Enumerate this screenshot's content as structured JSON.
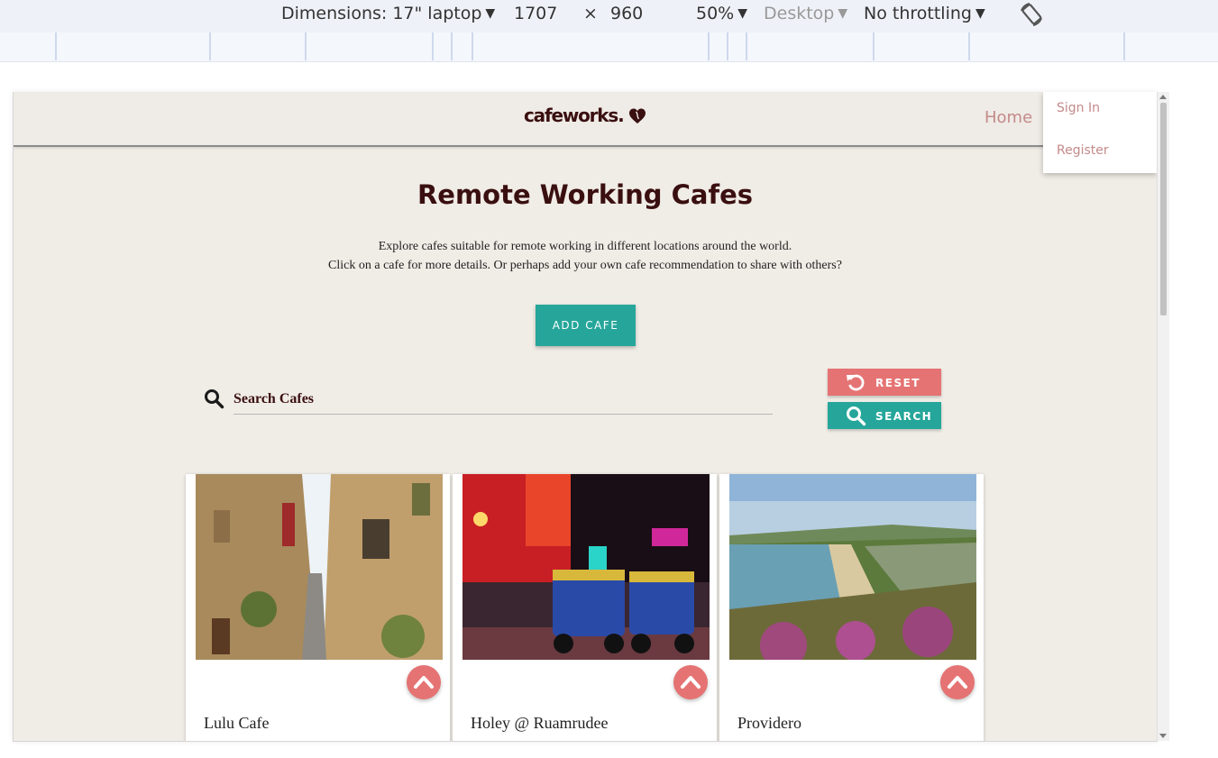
{
  "devtools": {
    "dimensions_label": "Dimensions: 17\" laptop",
    "width": "1707",
    "times": "×",
    "height": "960",
    "zoom": "50%",
    "device_type": "Desktop",
    "throttling": "No throttling",
    "rotate_icon": "rotate-icon"
  },
  "site": {
    "logo": "cafeworks.",
    "nav_home": "Home",
    "dropdown": {
      "sign_in": "Sign In",
      "register": "Register"
    }
  },
  "hero": {
    "title": "Remote Working Cafes",
    "line1": "Explore cafes suitable for remote working in different locations around the world.",
    "line2": "Click on a cafe for more details. Or perhaps add your own cafe recommendation to share with others?",
    "add_button": "ADD CAFE"
  },
  "search": {
    "placeholder": "Search Cafes",
    "reset_label": "RESET",
    "search_label": "SEARCH"
  },
  "cafes": [
    {
      "name": "Lulu Cafe",
      "image": "narrow-stone-street-photo"
    },
    {
      "name": "Holey @ Ruamrudee",
      "image": "neon-street-tuk-tuk-photo"
    },
    {
      "name": "Providero",
      "image": "coastal-bay-heather-photo"
    }
  ],
  "colors": {
    "brand": "#3a0f10",
    "accent_teal": "#26a69a",
    "accent_red": "#e57373",
    "link_pink": "#c48a8a",
    "page_bg": "#f0ece6"
  }
}
